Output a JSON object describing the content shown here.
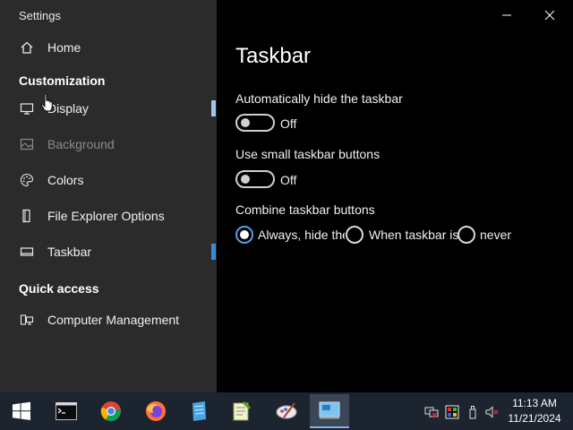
{
  "window": {
    "title": "Settings"
  },
  "sidebar": {
    "home": {
      "label": "Home",
      "icon": "home-icon"
    },
    "section_customization": "Customization",
    "items": [
      {
        "label": "Display",
        "icon": "monitor-icon",
        "dimmed": false
      },
      {
        "label": "Background",
        "icon": "picture-icon",
        "dimmed": true
      },
      {
        "label": "Colors",
        "icon": "palette-icon",
        "dimmed": false
      },
      {
        "label": "File Explorer Options",
        "icon": "document-icon",
        "dimmed": false
      },
      {
        "label": "Taskbar",
        "icon": "taskbar-icon",
        "dimmed": false,
        "selected": true
      }
    ],
    "section_quick": "Quick access",
    "quick_items": [
      {
        "label": "Computer Management",
        "icon": "computer-management-icon"
      }
    ]
  },
  "page": {
    "title": "Taskbar",
    "autohide": {
      "label": "Automatically hide the taskbar",
      "state": "Off"
    },
    "small_buttons": {
      "label": "Use small taskbar buttons",
      "state": "Off"
    },
    "combine": {
      "label": "Combine taskbar buttons",
      "options": [
        "Always, hide the",
        "When taskbar is",
        "never"
      ],
      "selected_index": 0
    }
  },
  "taskbar": {
    "apps": [
      "start-icon",
      "terminal-icon",
      "chrome-icon",
      "firefox-icon",
      "notepad-icon",
      "notepad-plus-icon",
      "paint-icon",
      "settings-app-icon"
    ],
    "clock": {
      "time": "11:13 AM",
      "date": "11/21/2024"
    }
  },
  "colors": {
    "accent": "#4d9fe8",
    "indicator": "#3b8ad9",
    "sidebar_bg": "#2b2b2b",
    "taskbar_bg": "#1c2430"
  }
}
